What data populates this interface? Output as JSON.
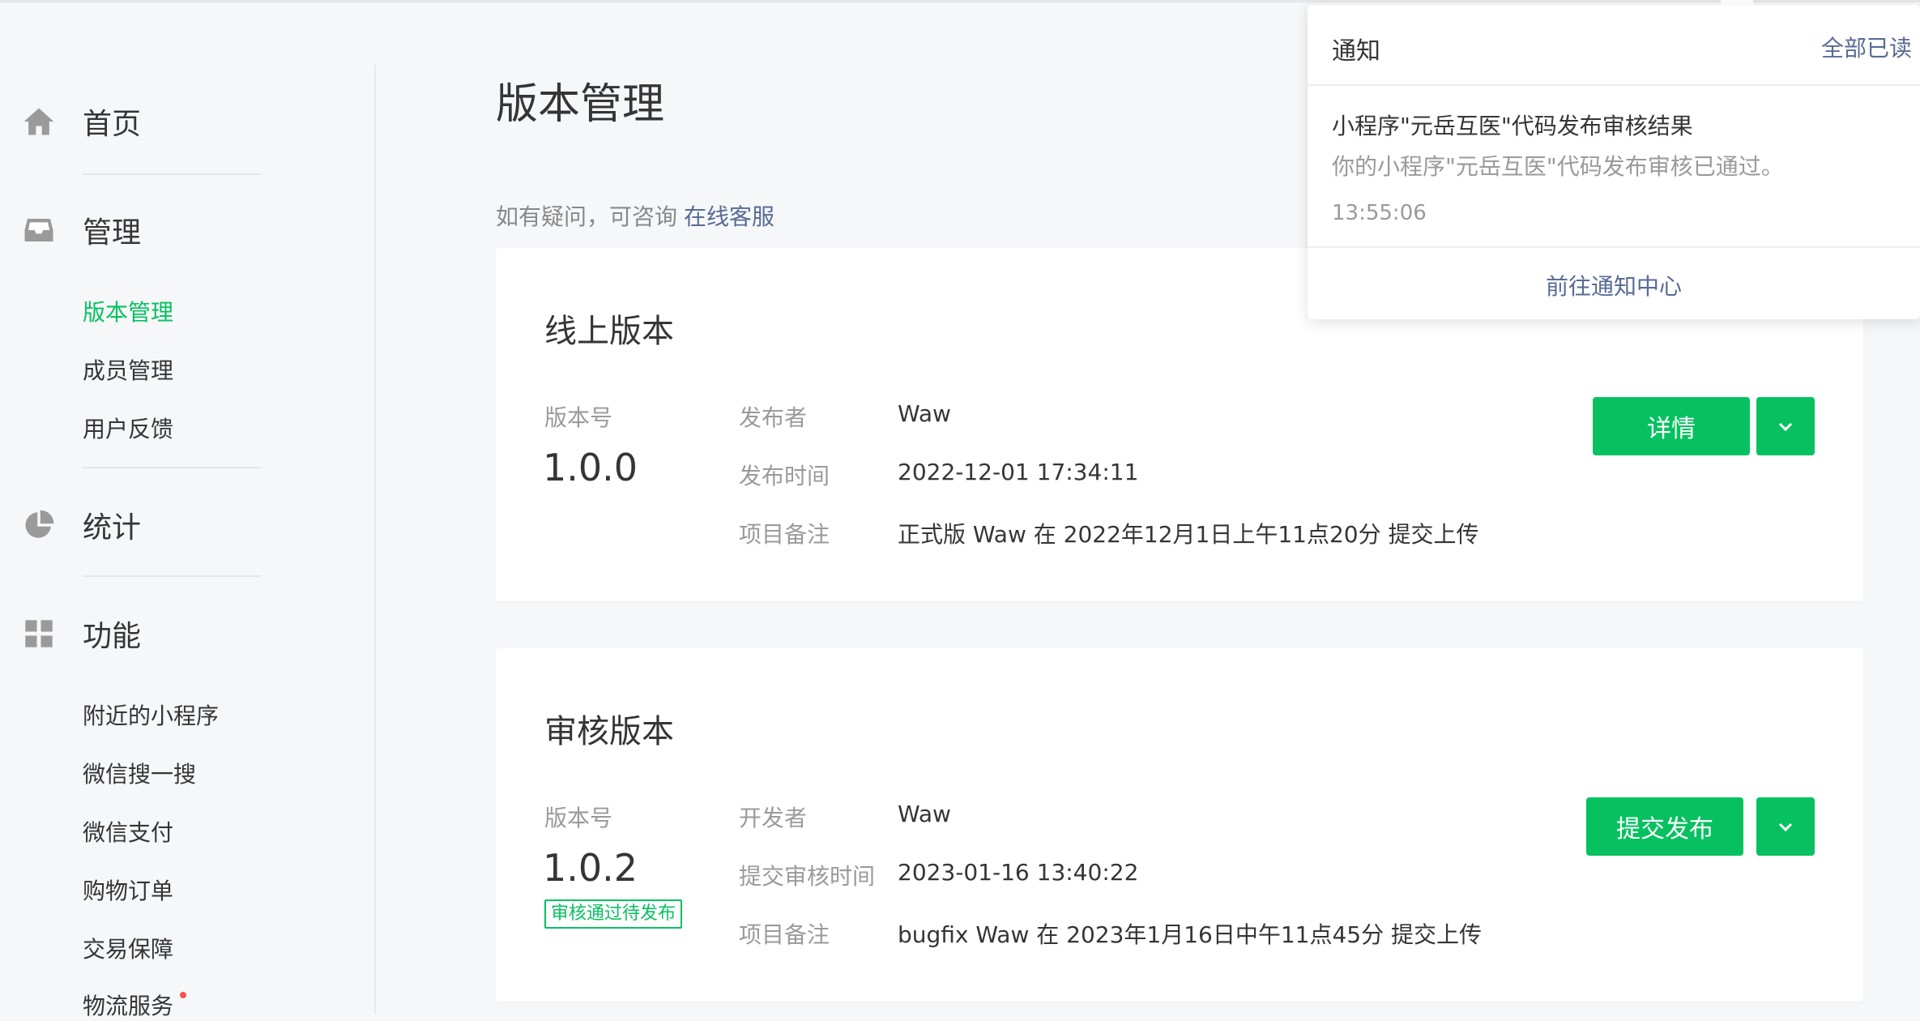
{
  "sidebar": {
    "groups": [
      {
        "label": "首页",
        "icon": "home-icon"
      },
      {
        "label": "管理",
        "icon": "inbox-icon"
      },
      {
        "label": "统计",
        "icon": "pie-chart-icon"
      },
      {
        "label": "功能",
        "icon": "grid-icon"
      }
    ],
    "management_items": [
      {
        "label": "版本管理",
        "active": true
      },
      {
        "label": "成员管理",
        "active": false
      },
      {
        "label": "用户反馈",
        "active": false
      }
    ],
    "feature_items": [
      {
        "label": "附近的小程序"
      },
      {
        "label": "微信搜一搜"
      },
      {
        "label": "微信支付"
      },
      {
        "label": "购物订单"
      },
      {
        "label": "交易保障"
      },
      {
        "label": "物流服务",
        "has_dot": true
      }
    ],
    "active_color": "#07c160"
  },
  "main": {
    "title": "版本管理",
    "help_text": "如有疑问，可咨询",
    "help_link": "在线客服"
  },
  "online_card": {
    "title": "线上版本",
    "version_label": "版本号",
    "version": "1.0.0",
    "fields": [
      {
        "label": "发布者",
        "value": "Waw"
      },
      {
        "label": "发布时间",
        "value": "2022-12-01 17:34:11"
      },
      {
        "label": "项目备注",
        "value": "正式版 Waw 在 2022年12月1日上午11点20分 提交上传"
      }
    ],
    "primary_button": "详情",
    "dropdown_icon": "chevron-down-icon"
  },
  "review_card": {
    "title": "审核版本",
    "version_label": "版本号",
    "version": "1.0.2",
    "status": "审核通过待发布",
    "fields": [
      {
        "label": "开发者",
        "value": "Waw"
      },
      {
        "label": "提交审核时间",
        "value": "2023-01-16 13:40:22"
      },
      {
        "label": "项目备注",
        "value": "bugfix Waw 在 2023年1月16日中午11点45分 提交上传"
      }
    ],
    "primary_button": "提交发布",
    "dropdown_icon": "chevron-down-icon"
  },
  "notification": {
    "title": "通知",
    "mark_all_read": "全部已读",
    "message_title": "小程序\"元岳互医\"代码发布审核结果",
    "message_body": "你的小程序\"元岳互医\"代码发布审核已通过。",
    "time": "13:55:06",
    "footer_link": "前往通知中心"
  },
  "colors": {
    "primary": "#07c160",
    "link": "#576b95",
    "muted": "#9a9a9a",
    "text": "#353535",
    "background": "#f6f7f9"
  }
}
